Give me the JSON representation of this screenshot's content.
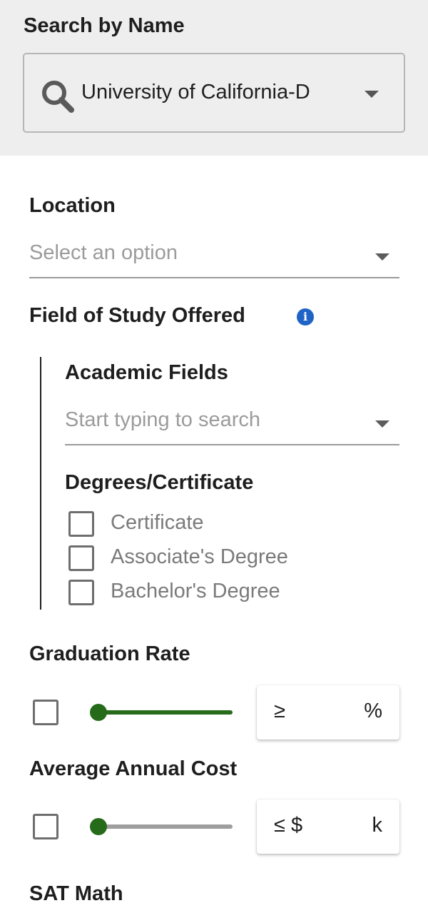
{
  "search_by_name": {
    "title": "Search by Name",
    "value": "University of California-D"
  },
  "location": {
    "label": "Location",
    "placeholder": "Select an option"
  },
  "field_of_study": {
    "label": "Field of Study Offered",
    "info_glyph": "i",
    "academic_fields": {
      "label": "Academic Fields",
      "placeholder": "Start typing to search"
    },
    "degrees": {
      "label": "Degrees/Certificate",
      "options": [
        {
          "label": "Certificate",
          "checked": false
        },
        {
          "label": "Associate's Degree",
          "checked": false
        },
        {
          "label": "Bachelor's Degree",
          "checked": false
        }
      ]
    }
  },
  "graduation_rate": {
    "label": "Graduation Rate",
    "checked": false,
    "slider_level": 0,
    "prefix": "≥",
    "suffix": "%",
    "track_color": "#256b1a"
  },
  "average_annual_cost": {
    "label": "Average Annual Cost",
    "checked": false,
    "slider_level": 0,
    "prefix": "≤ $",
    "suffix": "k",
    "track_color": "#9e9e9e"
  },
  "sat_math": {
    "label": "SAT Math"
  },
  "colors": {
    "accent_green": "#256b1a",
    "info_blue": "#1f63c6",
    "panel_gray": "#eeeeee"
  }
}
